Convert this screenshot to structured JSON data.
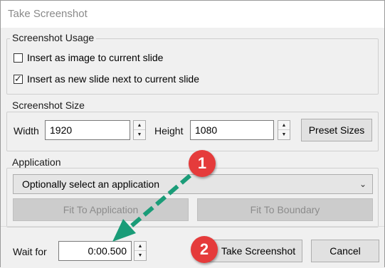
{
  "window": {
    "title": "Take Screenshot"
  },
  "usage": {
    "label": "Screenshot Usage",
    "options": [
      {
        "label": "Insert as image to current slide",
        "checked": false
      },
      {
        "label": "Insert as new slide next to current slide",
        "checked": true
      }
    ]
  },
  "size": {
    "label": "Screenshot Size",
    "width_label": "Width",
    "width_value": "1920",
    "height_label": "Height",
    "height_value": "1080",
    "preset_button": "Preset Sizes"
  },
  "application": {
    "label": "Application",
    "select_value": "Optionally select an application",
    "fit_app_button": "Fit To Application",
    "fit_boundary_button": "Fit To Boundary"
  },
  "footer": {
    "wait_label": "Wait for",
    "wait_value": "0:00.500",
    "take_button": "Take Screenshot",
    "cancel_button": "Cancel"
  },
  "annotations": {
    "badge1": "1",
    "badge2": "2",
    "badge_color": "#e53b3b",
    "arrow_color": "#1a9c78"
  },
  "icons": {
    "check": "✓",
    "spin_up": "▲",
    "spin_down": "▼",
    "chevron": "⌄"
  }
}
